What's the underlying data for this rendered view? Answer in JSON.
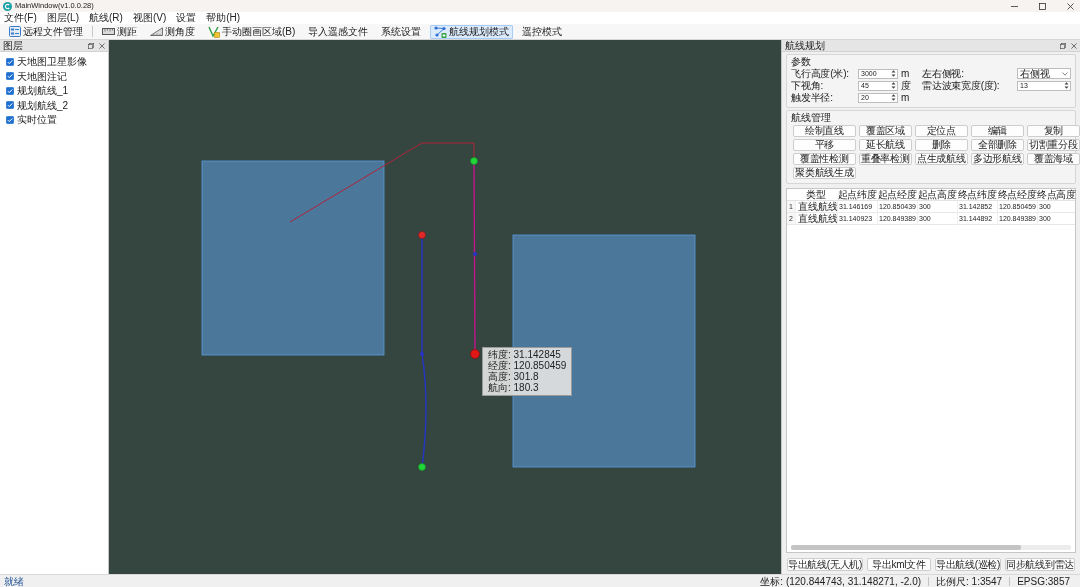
{
  "window": {
    "title": "MainWindow(v1.0.0.28)"
  },
  "menu": [
    {
      "label": "文件(F)"
    },
    {
      "label": "图层(L)"
    },
    {
      "label": "航线(R)"
    },
    {
      "label": "视图(V)"
    },
    {
      "label": "设置"
    },
    {
      "label": "帮助(H)"
    }
  ],
  "toolbar": [
    {
      "label": "远程文件管理",
      "selected": false
    },
    {
      "label": "测距",
      "selected": false
    },
    {
      "label": "测角度",
      "selected": false
    },
    {
      "label": "手动圈画区域(B)",
      "selected": false
    },
    {
      "label": "导入遥感文件",
      "selected": false
    },
    {
      "label": "系统设置",
      "selected": false
    },
    {
      "label": "航线规划模式",
      "selected": true
    },
    {
      "label": "遥控模式",
      "selected": false
    }
  ],
  "layers_panel": {
    "title": "图层",
    "items": [
      {
        "label": "天地图卫星影像",
        "checked": true
      },
      {
        "label": "天地图注记",
        "checked": true
      },
      {
        "label": "规划航线_1",
        "checked": true
      },
      {
        "label": "规划航线_2",
        "checked": true
      },
      {
        "label": "实时位置",
        "checked": true
      }
    ]
  },
  "map": {
    "tooltip": [
      "纬度: 31.142845",
      "经度: 120.850459",
      "高度: 301.8",
      "航向: 180.3"
    ]
  },
  "route_panel": {
    "title": "航线规划",
    "params": {
      "title": "参数",
      "fields": [
        {
          "kind": "spin",
          "label": "飞行高度(米):",
          "value": "3000",
          "unit": "m"
        },
        {
          "kind": "spin",
          "label": "下视角:",
          "value": "45",
          "unit": "度"
        },
        {
          "kind": "spin",
          "label": "触发半径:",
          "value": "20",
          "unit": "m"
        }
      ],
      "side_fields": [
        {
          "kind": "select",
          "label": "左右侧视:",
          "value": "右侧视"
        },
        {
          "kind": "spin",
          "label": "雷达波束宽度(度):",
          "value": "13"
        }
      ]
    },
    "management": {
      "title": "航线管理",
      "buttons": [
        "绘制直线",
        "覆盖区域",
        "定位点",
        "编辑",
        "复制",
        "平移",
        "延长航线",
        "删除",
        "全部删除",
        "切割重分段",
        "覆盖性检测",
        "重叠率检测",
        "点生成航线",
        "多边形航线",
        "覆盖海域",
        "聚类航线生成"
      ]
    },
    "table": {
      "columns": [
        "类型",
        "起点纬度",
        "起点经度",
        "起点高度",
        "终点纬度",
        "终点经度",
        "终点高度"
      ],
      "rows": [
        {
          "index": "1",
          "cells": [
            "直线航线",
            "31.146169",
            "120.850439",
            "300",
            "31.142852",
            "120.850459",
            "300"
          ]
        },
        {
          "index": "2",
          "cells": [
            "直线航线",
            "31.140923",
            "120.849389",
            "300",
            "31.144892",
            "120.849389",
            "300"
          ]
        }
      ]
    },
    "export_buttons": [
      "导出航线(无人机)",
      "导出kml文件",
      "导出航线(巡检)",
      "同步航线到雷达"
    ]
  },
  "status_bar": {
    "message": "就绪",
    "coordinates": "坐标: (120.844743, 31.148271, -2.0)",
    "scale": "比例尺: 1:3547",
    "crs": "EPSG:3857"
  }
}
